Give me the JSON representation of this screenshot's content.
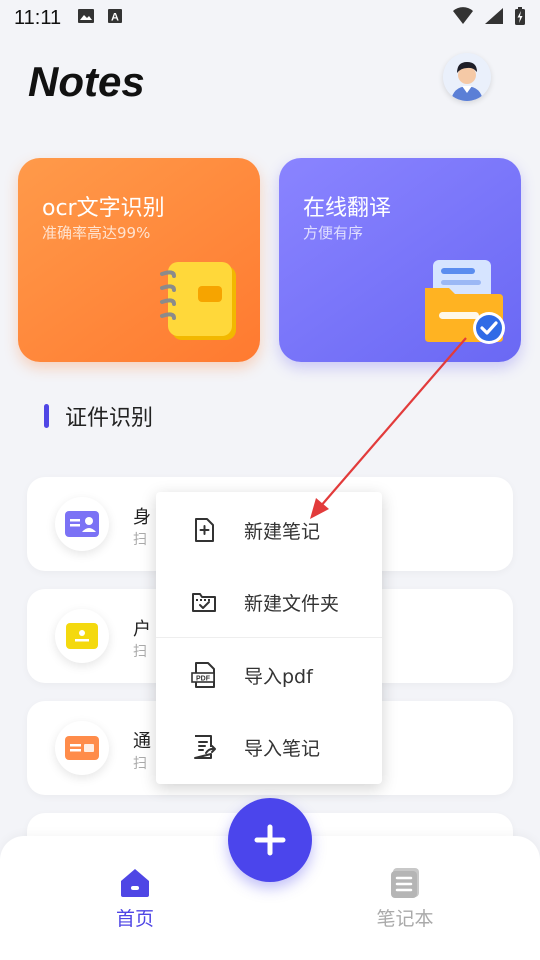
{
  "status_bar": {
    "time": "11:11",
    "icons": [
      "image-icon",
      "keyboard-a-icon",
      "wifi-icon",
      "signal-icon",
      "battery-charging-icon"
    ]
  },
  "header": {
    "title": "Notes",
    "avatar_icon": "user-avatar-icon"
  },
  "feature_cards": [
    {
      "title": "ocr文字识别",
      "subtitle": "准确率高达99%",
      "icon": "notebook-icon",
      "accent": "#ff8a3d"
    },
    {
      "title": "在线翻译",
      "subtitle": "方便有序",
      "icon": "folder-check-icon",
      "accent": "#7a76fa"
    }
  ],
  "section": {
    "title": "证件识别",
    "accent": "#4f46e5"
  },
  "list_items": [
    {
      "title": "身",
      "subtitle": "扫",
      "icon": "id-card-icon"
    },
    {
      "title": "户",
      "subtitle": "扫",
      "icon": "household-book-icon"
    },
    {
      "title": "通",
      "subtitle": "扫",
      "icon": "license-icon"
    }
  ],
  "popup_menu": {
    "items": [
      {
        "label": "新建笔记",
        "icon": "new-note-icon"
      },
      {
        "label": "新建文件夹",
        "icon": "new-folder-icon"
      },
      {
        "label": "导入pdf",
        "icon": "pdf-icon"
      },
      {
        "label": "导入笔记",
        "icon": "import-note-icon"
      }
    ]
  },
  "fab": {
    "icon": "plus-icon",
    "color": "#4b45ec"
  },
  "bottom_nav": {
    "tabs": [
      {
        "label": "首页",
        "icon": "home-icon",
        "active": true
      },
      {
        "label": "笔记本",
        "icon": "notebook-stack-icon",
        "active": false
      }
    ],
    "active_color": "#4f46e5",
    "inactive_color": "#aaaaaa"
  },
  "annotation": {
    "color": "#e23b3b"
  }
}
